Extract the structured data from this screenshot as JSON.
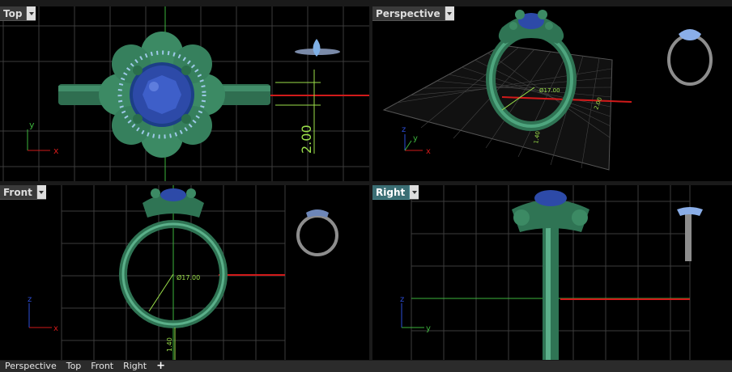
{
  "viewports": {
    "top": {
      "name": "Top",
      "dimension": "2.00"
    },
    "perspective": {
      "name": "Perspective",
      "dimension_diameter": "Ø17.00",
      "dimension_small_a": "1.40",
      "dimension_small_b": "2.00"
    },
    "front": {
      "name": "Front",
      "dimension_diameter": "Ø17.00",
      "dimension_small": "1.40"
    },
    "right": {
      "name": "Right"
    }
  },
  "axes": {
    "x": "x",
    "y": "y",
    "z": "z"
  },
  "tabs": [
    {
      "label": "Perspective"
    },
    {
      "label": "Top"
    },
    {
      "label": "Front"
    },
    {
      "label": "Right"
    },
    {
      "label": "+"
    }
  ],
  "colors": {
    "ring_green": "#3f8a66",
    "gem_blue": "#2d4aa8",
    "accent_red": "#d11a1a",
    "dimension_green": "#9be04a",
    "active_tab": "#3b6e74"
  }
}
